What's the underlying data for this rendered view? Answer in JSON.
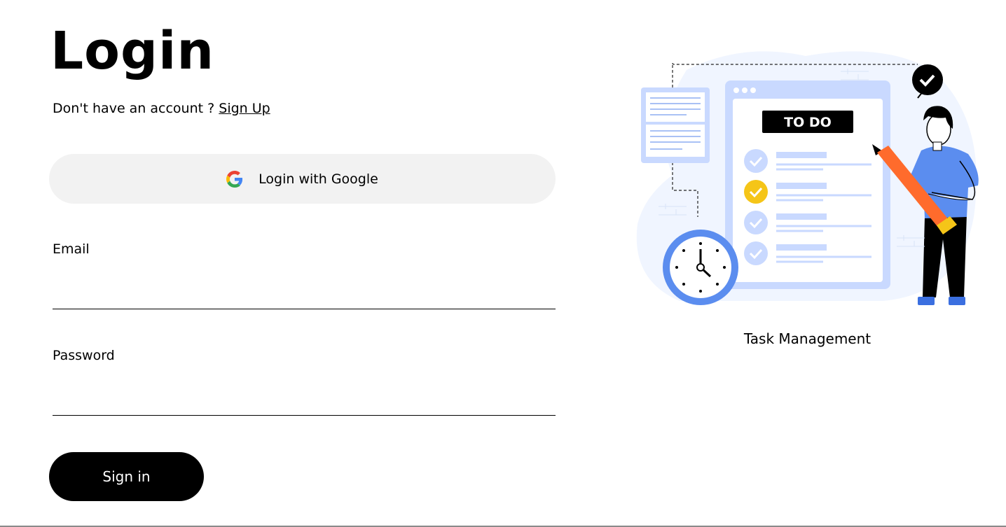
{
  "login": {
    "title": "Login",
    "signup_prompt": "Don't have an account ?",
    "signup_link": "Sign Up",
    "google_button": "Login with Google",
    "email_label": "Email",
    "email_value": "",
    "password_label": "Password",
    "password_value": "",
    "signin_button": "Sign in"
  },
  "illustration": {
    "todo_heading": "TO DO",
    "caption": "Task Management",
    "icon": "task-management-illustration"
  },
  "colors": {
    "primary": "#000000",
    "google_button_bg": "#f2f2f2",
    "illustration_blue": "#5b8def",
    "illustration_light": "#c9d9ff",
    "accent_yellow": "#f5c518",
    "pencil_orange": "#ff6b2c"
  }
}
